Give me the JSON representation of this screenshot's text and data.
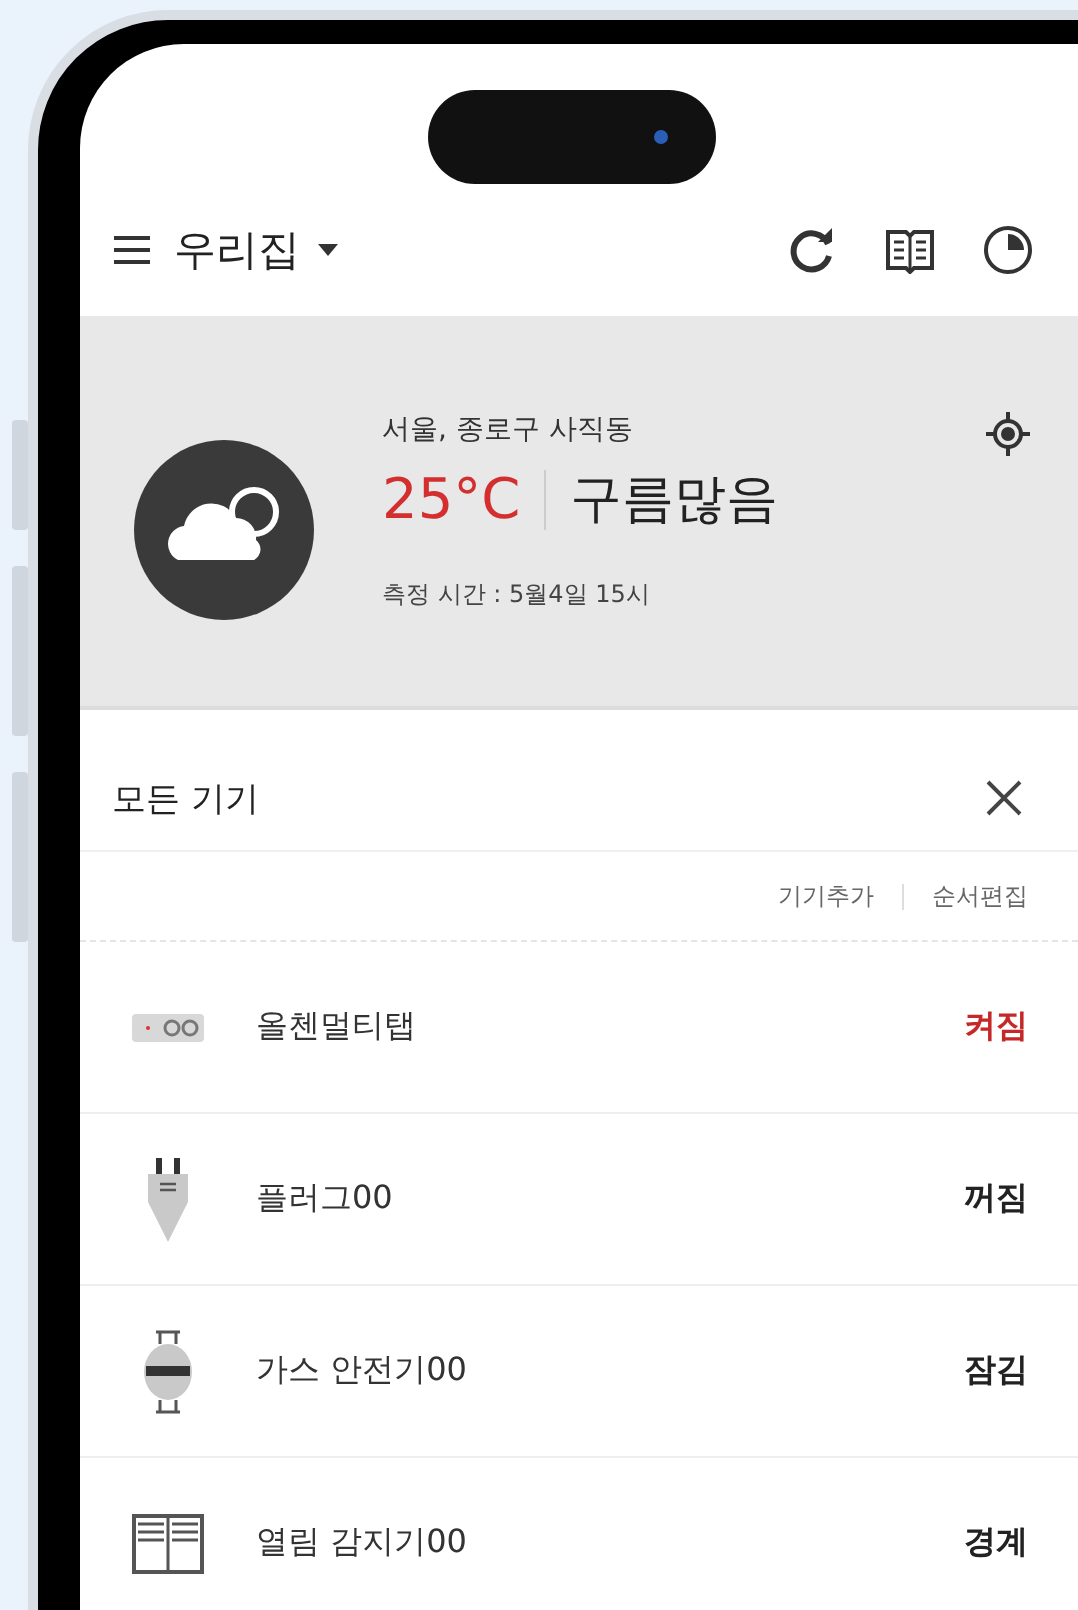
{
  "header": {
    "home_name": "우리집"
  },
  "weather": {
    "location": "서울, 종로구 사직동",
    "temperature": "25°C",
    "condition": "구름많음",
    "measured_time": "측정 시간 : 5월4일 15시"
  },
  "device_panel": {
    "title": "모든 기기",
    "actions": [
      "기기추가",
      "순서편집"
    ]
  },
  "devices": [
    {
      "kind": "multitap",
      "name": "올첸멀티탭",
      "state": "켜짐",
      "active": true
    },
    {
      "kind": "plug",
      "name": "플러그00",
      "state": "꺼짐",
      "active": false
    },
    {
      "kind": "gas",
      "name": "가스 안전기00",
      "state": "잠김",
      "active": false
    },
    {
      "kind": "window",
      "name": "열림 감지기00",
      "state": "경계",
      "active": false
    }
  ]
}
